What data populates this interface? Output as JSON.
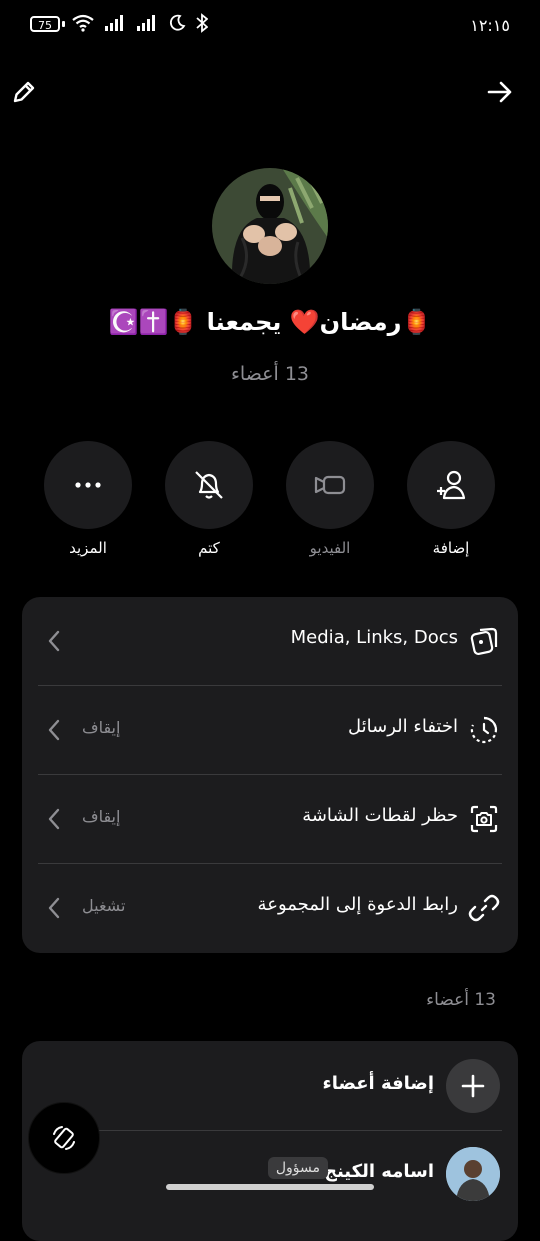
{
  "status_bar": {
    "battery": "75",
    "time": "١٢:١٥"
  },
  "header": {
    "edit_icon": "pencil-icon",
    "forward_icon": "arrow-right-icon"
  },
  "group": {
    "name": "🏮رمضان❤️ يجمعنا 🏮✝️☪️",
    "member_count": "13 أعضاء"
  },
  "actions": [
    {
      "label": "إضافة",
      "icon": "add-person-icon",
      "enabled": true
    },
    {
      "label": "الفيديو",
      "icon": "video-icon",
      "enabled": false
    },
    {
      "label": "كتم",
      "icon": "bell-off-icon",
      "enabled": true
    },
    {
      "label": "المزيد",
      "icon": "more-icon",
      "enabled": true
    }
  ],
  "settings": [
    {
      "title": "Media, Links, Docs",
      "value": "",
      "icon": "media-icon"
    },
    {
      "title": "اختفاء الرسائل",
      "value": "إيقاف",
      "icon": "timer-icon"
    },
    {
      "title": "حظر لقطات الشاشة",
      "value": "إيقاف",
      "icon": "screenshot-icon"
    },
    {
      "title": "رابط الدعوة إلى المجموعة",
      "value": "تشغيل",
      "icon": "link-icon"
    }
  ],
  "members_section": {
    "label": "13 أعضاء",
    "add_label": "إضافة أعضاء",
    "members": [
      {
        "name": "اسامه الكينج",
        "badge": "مسؤول"
      }
    ]
  }
}
